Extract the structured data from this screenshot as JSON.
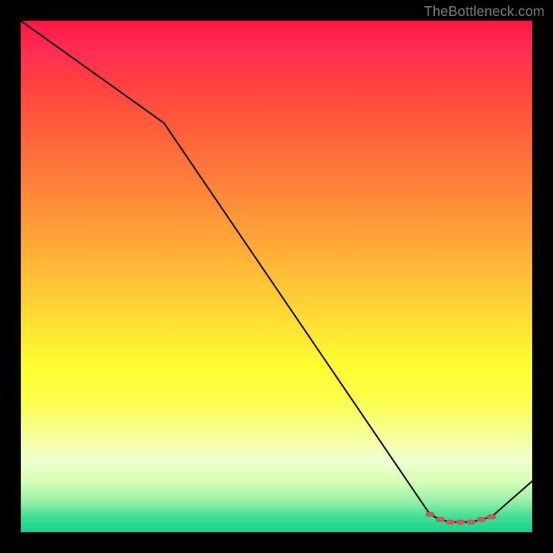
{
  "watermark": "TheBottleneck.com",
  "chart_data": {
    "type": "line",
    "title": "",
    "xlabel": "",
    "ylabel": "",
    "xlim": [
      0,
      100
    ],
    "ylim": [
      0,
      100
    ],
    "grid": false,
    "legend": false,
    "background_gradient": {
      "top_color": "#ff1744",
      "bottom_color": "#17d38c",
      "description": "vertical red-to-green heat gradient"
    },
    "series": [
      {
        "name": "bottleneck-curve",
        "stroke": "#000000",
        "x": [
          0,
          28,
          80,
          82,
          84,
          86,
          88,
          90,
          92,
          100
        ],
        "values": [
          100,
          80,
          3.5,
          2.5,
          2,
          2,
          2,
          2.5,
          3,
          10
        ]
      }
    ],
    "markers": {
      "name": "optimal-range",
      "shape": "rounded-dash",
      "fill": "#d05a5a",
      "stroke": "#c04848",
      "x": [
        80,
        82,
        84,
        86,
        88,
        90,
        92
      ],
      "values": [
        3.5,
        2.5,
        2,
        2,
        2,
        2.5,
        3
      ]
    }
  }
}
